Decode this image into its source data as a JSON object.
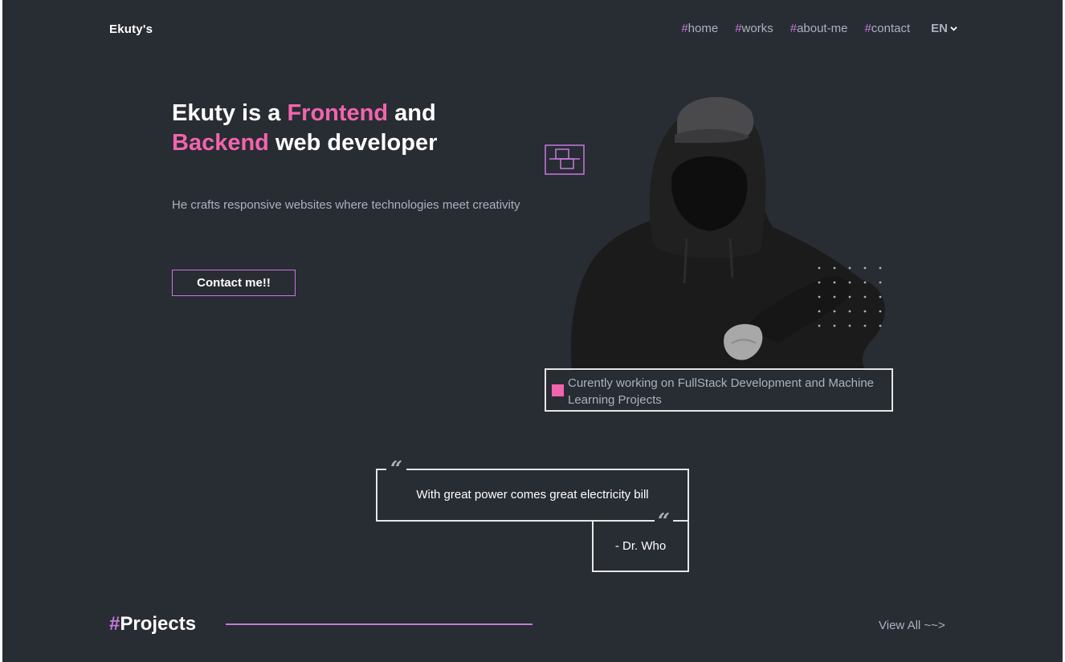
{
  "header": {
    "logo": "Ekuty's",
    "nav": [
      {
        "hash": "#",
        "label": "home"
      },
      {
        "hash": "#",
        "label": "works"
      },
      {
        "hash": "#",
        "label": "about-me"
      },
      {
        "hash": "#",
        "label": "contact"
      }
    ],
    "language": "EN"
  },
  "hero": {
    "title_part1": "Ekuty is a ",
    "title_highlight1": "Frontend",
    "title_part2": " and",
    "title_highlight2": "Backend",
    "title_part3": " web developer",
    "subtitle": "He crafts responsive websites where technologies meet creativity",
    "cta_label": "Contact me!!",
    "status": "Curently working on FullStack Development and Machine Learning Projects"
  },
  "quote": {
    "mark": "“",
    "text": "With great power comes great electricity bill",
    "author": "- Dr. Who"
  },
  "projects": {
    "hash": "#",
    "title": "Projects",
    "view_all": "View All ~~>"
  },
  "colors": {
    "background": "#282c33",
    "accent_purple": "#c778dd",
    "accent_pink": "#f165ac",
    "muted_text": "#abb2bf"
  }
}
